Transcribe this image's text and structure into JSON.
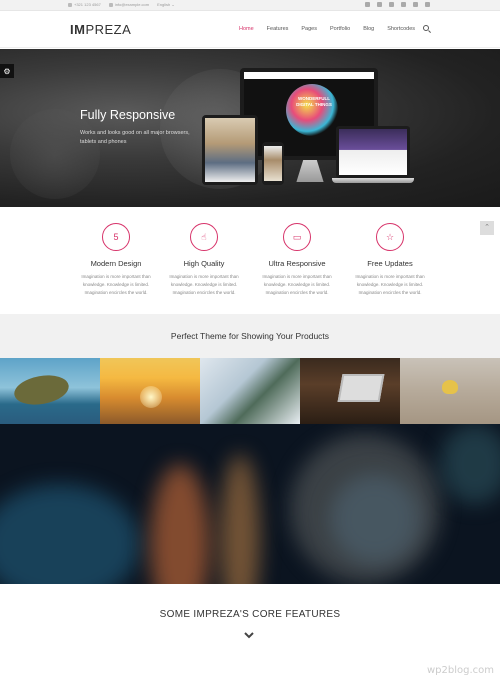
{
  "topbar": {
    "phone": "+321 123 4567",
    "email": "info@example.com",
    "language": "English",
    "social_icons": [
      "facebook-icon",
      "twitter-icon",
      "vine-icon",
      "linkedin-icon",
      "youtube-icon",
      "instagram-icon"
    ]
  },
  "header": {
    "logo_bold": "IM",
    "logo_rest": "PREZA",
    "nav": [
      "Home",
      "Features",
      "Pages",
      "Portfolio",
      "Blog",
      "Shortcodes"
    ],
    "active_nav": "Home"
  },
  "hero": {
    "title": "Fully Responsive",
    "subtitle": "Works and looks good on all major browsers, tablets and phones",
    "screen_text": "WONDERFULL DIGITAL THINGS",
    "screen_logo": "IMPREZA"
  },
  "features": [
    {
      "icon": "html5-icon",
      "title": "Modern Design",
      "text": "Imagination is more important than knowledge. Knowledge is limited. Imagination encircles the world."
    },
    {
      "icon": "thumbs-up-icon",
      "title": "High Quality",
      "text": "Imagination is more important than knowledge. Knowledge is limited. Imagination encircles the world."
    },
    {
      "icon": "tablet-icon",
      "title": "Ultra Responsive",
      "text": "Imagination is more important than knowledge. Knowledge is limited. Imagination encircles the world."
    },
    {
      "icon": "star-icon",
      "title": "Free Updates",
      "text": "Imagination is more important than knowledge. Knowledge is limited. Imagination encircles the world."
    }
  ],
  "products": {
    "title": "Perfect Theme for Showing Your Products"
  },
  "core": {
    "title": "SOME IMPREZA'S CORE FEATURES"
  },
  "watermark": "wp2blog.com",
  "colors": {
    "accent": "#d7336a",
    "hero_bg": "#2a2a2a",
    "band_bg": "#f1f1f1"
  }
}
